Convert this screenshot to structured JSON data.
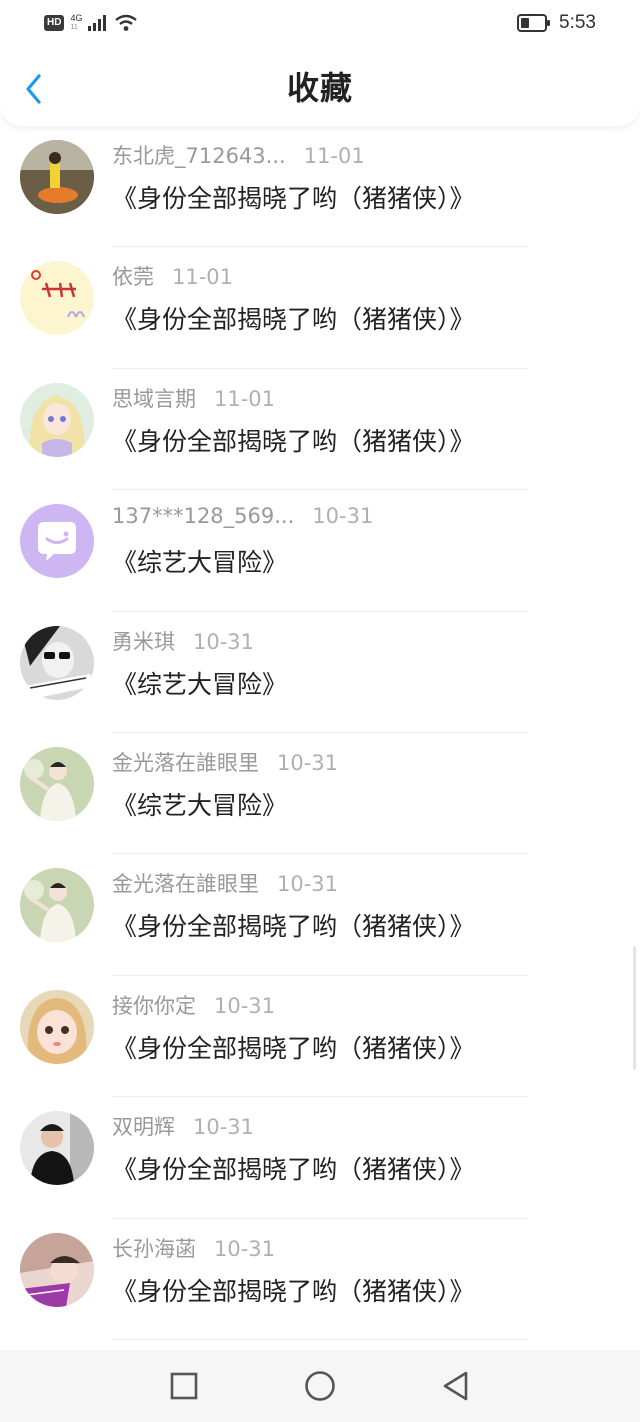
{
  "status": {
    "hd": "HD",
    "network": "4G",
    "network_sub": "11",
    "time": "5:53",
    "battery_level": 0.35
  },
  "header": {
    "title": "收藏",
    "back_icon": "chevron-left-icon",
    "accent_color": "#1a9af0"
  },
  "items": [
    {
      "username": "东北虎_712643...",
      "date": "11-01",
      "title": "《身份全部揭晓了哟（猪猪侠）》",
      "avatar": "campfire-photo"
    },
    {
      "username": "依莞",
      "date": "11-01",
      "title": "《身份全部揭晓了哟（猪猪侠）》",
      "avatar": "cartoon-sticker"
    },
    {
      "username": "思域言期",
      "date": "11-01",
      "title": "《身份全部揭晓了哟（猪猪侠）》",
      "avatar": "anime-girl"
    },
    {
      "username": "137***128_569...",
      "date": "10-31",
      "title": "《综艺大冒险》",
      "avatar": "chat-bubble-default"
    },
    {
      "username": "勇米琪",
      "date": "10-31",
      "title": "《综艺大冒险》",
      "avatar": "bw-glasses-photo"
    },
    {
      "username": "金光落在誰眼里",
      "date": "10-31",
      "title": "《综艺大冒险》",
      "avatar": "girl-white-dress"
    },
    {
      "username": "金光落在誰眼里",
      "date": "10-31",
      "title": "《身份全部揭晓了哟（猪猪侠）》",
      "avatar": "girl-white-dress"
    },
    {
      "username": "接你你定",
      "date": "10-31",
      "title": "《身份全部揭晓了哟（猪猪侠）》",
      "avatar": "doll-face"
    },
    {
      "username": "双明辉",
      "date": "10-31",
      "title": "《身份全部揭晓了哟（猪猪侠）》",
      "avatar": "man-dark-photo"
    },
    {
      "username": "长孙海菡",
      "date": "10-31",
      "title": "《身份全部揭晓了哟（猪猪侠）》",
      "avatar": "girl-pink-photo"
    }
  ],
  "nav": {
    "recents": "square-icon",
    "home": "circle-icon",
    "back": "triangle-back-icon"
  }
}
